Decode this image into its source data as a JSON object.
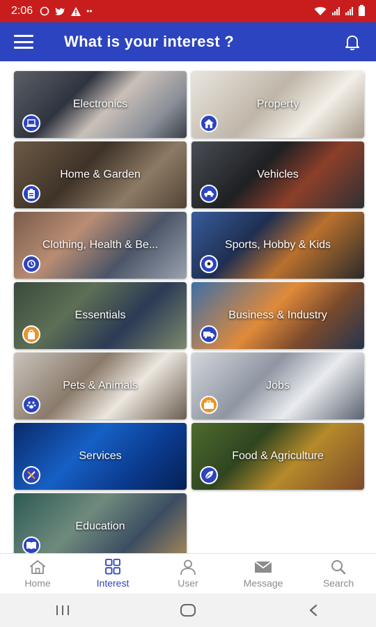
{
  "status_bar": {
    "time": "2:06",
    "bg_color": "#c91d1d"
  },
  "app_bar": {
    "title": "What is your interest ?",
    "bg_color": "#2c44bf",
    "icons": [
      "menu-icon",
      "bell-icon"
    ]
  },
  "categories": [
    {
      "label": "Electronics",
      "icon": "laptop-icon"
    },
    {
      "label": "Property",
      "icon": "house-icon"
    },
    {
      "label": "Home & Garden",
      "icon": "clipboard-icon"
    },
    {
      "label": "Vehicles",
      "icon": "car-icon"
    },
    {
      "label": "Clothing, Health & Be...",
      "icon": "watch-icon"
    },
    {
      "label": "Sports, Hobby & Kids",
      "icon": "soccer-ball-icon"
    },
    {
      "label": "Essentials",
      "icon": "shopping-bag-icon"
    },
    {
      "label": "Business & Industry",
      "icon": "truck-icon"
    },
    {
      "label": "Pets & Animals",
      "icon": "pet-icon"
    },
    {
      "label": "Jobs",
      "icon": "briefcase-icon"
    },
    {
      "label": "Services",
      "icon": "tools-icon"
    },
    {
      "label": "Food & Agriculture",
      "icon": "leaf-icon"
    },
    {
      "label": "Education",
      "icon": "book-icon"
    }
  ],
  "bottom_nav": {
    "items": [
      {
        "label": "Home",
        "icon": "home-icon",
        "active": false
      },
      {
        "label": "Interest",
        "icon": "grid-icon",
        "active": true
      },
      {
        "label": "User",
        "icon": "user-icon",
        "active": false
      },
      {
        "label": "Message",
        "icon": "mail-icon",
        "active": false
      },
      {
        "label": "Search",
        "icon": "search-icon",
        "active": false
      }
    ],
    "active_color": "#2c44bf",
    "inactive_color": "#8c8c8c"
  },
  "system_nav": {
    "icons": [
      "recents-icon",
      "home-circle-icon",
      "back-icon"
    ]
  }
}
